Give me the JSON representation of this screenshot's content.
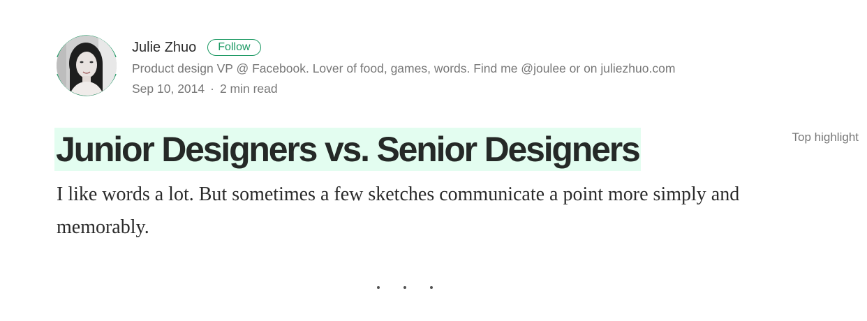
{
  "author": {
    "name": "Julie Zhuo",
    "follow_label": "Follow",
    "bio": "Product design VP @ Facebook. Lover of food, games, words. Find me @joulee or on juliezhuo.com",
    "date": "Sep 10, 2014",
    "separator": "·",
    "read_time": "2 min read",
    "avatar_icon": "avatar-photo",
    "ring_color": "#1c9963"
  },
  "article": {
    "title": "Junior Designers vs. Senior Designers",
    "title_highlight_color": "#e3fdf0",
    "intro": "I like words a lot. But sometimes a few sketches communicate a point more simply and memorably."
  },
  "sidebar": {
    "top_highlight_label": "Top highlight"
  },
  "divider": {
    "icon": "section-divider-dots"
  }
}
